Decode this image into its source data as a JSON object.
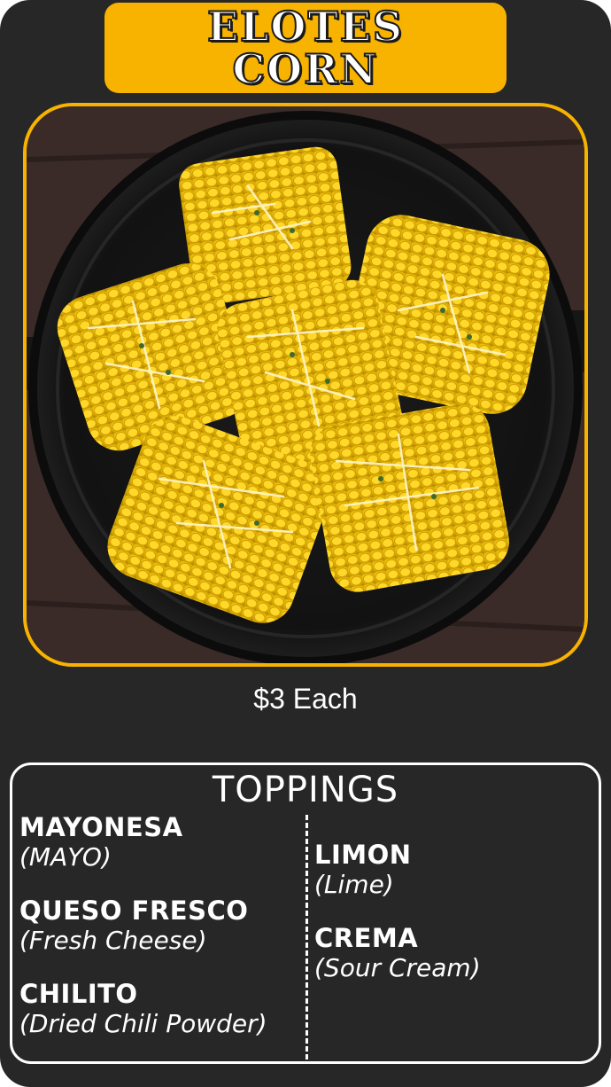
{
  "header": {
    "title_line1": "ELOTES",
    "title_line2": "CORN"
  },
  "photo": {
    "subject": "corn-on-the-cob pieces with grated cheese and thyme in a cast iron skillet"
  },
  "price": "$3 Each",
  "toppings": {
    "title": "TOPPINGS",
    "left": [
      {
        "name": "MAYONESA",
        "desc": "(MAYO)"
      },
      {
        "name": "QUESO FRESCO",
        "desc": "(Fresh Cheese)"
      },
      {
        "name": "CHILITO",
        "desc": "(Dried Chili Powder)"
      }
    ],
    "right": [
      {
        "name": "LIMON",
        "desc": "(Lime)"
      },
      {
        "name": "CREMA",
        "desc": "(Sour Cream)"
      }
    ]
  },
  "colors": {
    "background": "#272727",
    "accent": "#f7b300",
    "text": "#ffffff"
  }
}
